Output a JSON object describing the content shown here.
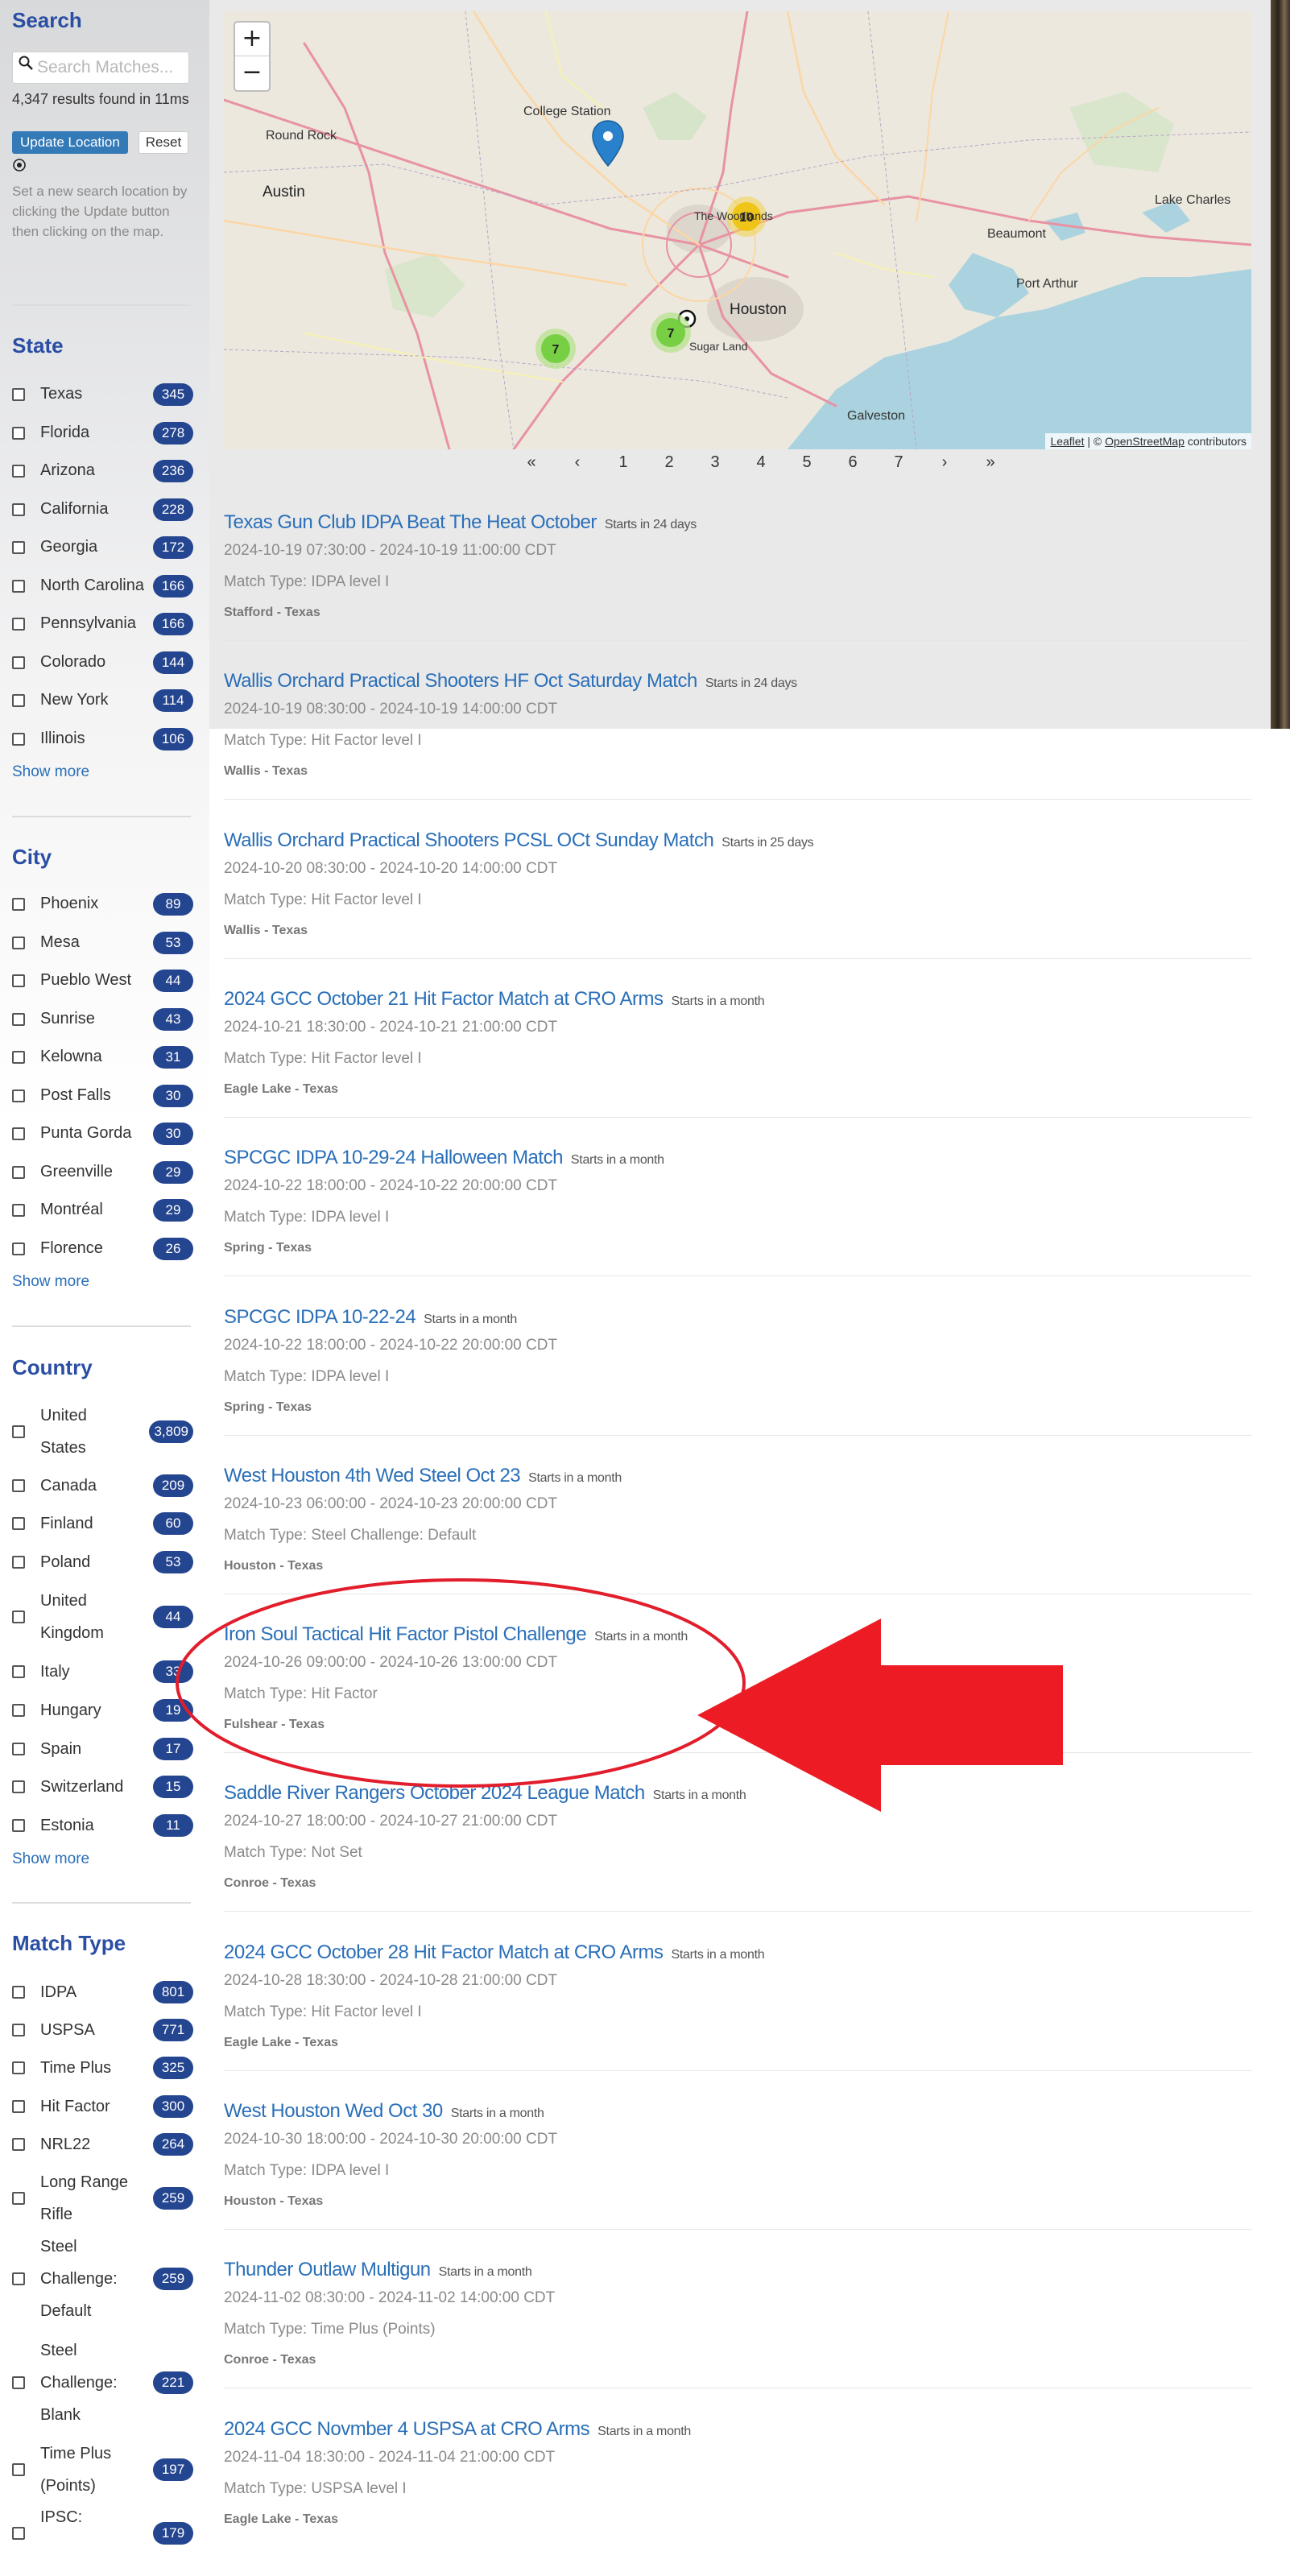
{
  "colors": {
    "accent": "#2a4ea3",
    "badge": "#24458f",
    "link": "#2a6fb8",
    "annotation_red": "#ed1c24"
  },
  "search": {
    "title": "Search",
    "placeholder": "Search Matches...",
    "results_text": "4,347 results found in 11ms",
    "update_button": "Update Location",
    "reset_button": "Reset",
    "help_text": "Set a new search location by clicking the Update button then clicking on the map."
  },
  "state": {
    "title": "State",
    "items": [
      {
        "label": "Texas",
        "count": "345"
      },
      {
        "label": "Florida",
        "count": "278"
      },
      {
        "label": "Arizona",
        "count": "236"
      },
      {
        "label": "California",
        "count": "228"
      },
      {
        "label": "Georgia",
        "count": "172"
      },
      {
        "label": "North Carolina",
        "count": "166"
      },
      {
        "label": "Pennsylvania",
        "count": "166"
      },
      {
        "label": "Colorado",
        "count": "144"
      },
      {
        "label": "New York",
        "count": "114"
      },
      {
        "label": "Illinois",
        "count": "106"
      }
    ],
    "show_more": "Show more"
  },
  "city": {
    "title": "City",
    "items": [
      {
        "label": "Phoenix",
        "count": "89"
      },
      {
        "label": "Mesa",
        "count": "53"
      },
      {
        "label": "Pueblo West",
        "count": "44"
      },
      {
        "label": "Sunrise",
        "count": "43"
      },
      {
        "label": "Kelowna",
        "count": "31"
      },
      {
        "label": "Post Falls",
        "count": "30"
      },
      {
        "label": "Punta Gorda",
        "count": "30"
      },
      {
        "label": "Greenville",
        "count": "29"
      },
      {
        "label": "Montréal",
        "count": "29"
      },
      {
        "label": "Florence",
        "count": "26"
      }
    ],
    "show_more": "Show more"
  },
  "country": {
    "title": "Country",
    "items": [
      {
        "label1": "United",
        "label2": "States",
        "count": "3,809"
      },
      {
        "label1": "Canada",
        "label2": "",
        "count": "209"
      },
      {
        "label1": "Finland",
        "label2": "",
        "count": "60"
      },
      {
        "label1": "Poland",
        "label2": "",
        "count": "53"
      },
      {
        "label1": "United",
        "label2": "Kingdom",
        "count": "44"
      },
      {
        "label1": "Italy",
        "label2": "",
        "count": "33"
      },
      {
        "label1": "Hungary",
        "label2": "",
        "count": "19"
      },
      {
        "label1": "Spain",
        "label2": "",
        "count": "17"
      },
      {
        "label1": "Switzerland",
        "label2": "",
        "count": "15"
      },
      {
        "label1": "Estonia",
        "label2": "",
        "count": "11"
      }
    ],
    "show_more": "Show more"
  },
  "match_type": {
    "title": "Match Type",
    "items": [
      {
        "lines": [
          "IDPA"
        ],
        "count": "801"
      },
      {
        "lines": [
          "USPSA"
        ],
        "count": "771"
      },
      {
        "lines": [
          "Time Plus"
        ],
        "count": "325"
      },
      {
        "lines": [
          "Hit Factor"
        ],
        "count": "300"
      },
      {
        "lines": [
          "NRL22"
        ],
        "count": "264"
      },
      {
        "lines": [
          "Long Range",
          "Rifle"
        ],
        "count": "259"
      },
      {
        "lines": [
          "Steel",
          "Challenge:",
          "Default"
        ],
        "count": "259"
      },
      {
        "lines": [
          "Steel",
          "Challenge:",
          "Blank"
        ],
        "count": "221"
      },
      {
        "lines": [
          "Time Plus",
          "(Points)"
        ],
        "count": "197"
      },
      {
        "lines": [
          "IPSC:",
          ""
        ],
        "count": "179"
      }
    ]
  },
  "map": {
    "zoom_in": "+",
    "zoom_out": "−",
    "attribution_leaflet": "Leaflet",
    "attribution_sep": " | © ",
    "attribution_osm": "OpenStreetMap",
    "attribution_tail": " contributors",
    "places": [
      "College Station",
      "Round Rock",
      "Austin",
      "Houston",
      "Beaumont",
      "Lake Charles",
      "Port Arthur",
      "Galveston",
      "Sugar Land",
      "The Woodlands"
    ],
    "clusters": [
      "10",
      "7",
      "7"
    ]
  },
  "pagination": [
    "«",
    "‹",
    "1",
    "2",
    "3",
    "4",
    "5",
    "6",
    "7",
    "›",
    "»"
  ],
  "matches": [
    {
      "title": "Texas Gun Club IDPA Beat The Heat October",
      "starts": "Starts in 24 days",
      "dates": "2024-10-19 07:30:00 - 2024-10-19 11:00:00 CDT",
      "type": "Match Type: IDPA level I",
      "location": "Stafford - Texas"
    },
    {
      "title": "Wallis Orchard Practical Shooters HF Oct Saturday Match",
      "starts": "Starts in 24 days",
      "dates": "2024-10-19 08:30:00 - 2024-10-19 14:00:00 CDT",
      "type": "Match Type: Hit Factor level I",
      "location": "Wallis - Texas"
    },
    {
      "title": "Wallis Orchard Practical Shooters PCSL OCt Sunday Match",
      "starts": "Starts in 25 days",
      "dates": "2024-10-20 08:30:00 - 2024-10-20 14:00:00 CDT",
      "type": "Match Type: Hit Factor level I",
      "location": "Wallis - Texas"
    },
    {
      "title": "2024 GCC October 21 Hit Factor Match at CRO Arms",
      "starts": "Starts in a month",
      "dates": "2024-10-21 18:30:00 - 2024-10-21 21:00:00 CDT",
      "type": "Match Type: Hit Factor level I",
      "location": "Eagle Lake - Texas"
    },
    {
      "title": "SPCGC IDPA 10-29-24 Halloween Match",
      "starts": "Starts in a month",
      "dates": "2024-10-22 18:00:00 - 2024-10-22 20:00:00 CDT",
      "type": "Match Type: IDPA level I",
      "location": "Spring - Texas"
    },
    {
      "title": "SPCGC IDPA 10-22-24",
      "starts": "Starts in a month",
      "dates": "2024-10-22 18:00:00 - 2024-10-22 20:00:00 CDT",
      "type": "Match Type: IDPA level I",
      "location": "Spring - Texas"
    },
    {
      "title": "West Houston 4th Wed Steel Oct 23",
      "starts": "Starts in a month",
      "dates": "2024-10-23 06:00:00 - 2024-10-23 20:00:00 CDT",
      "type": "Match Type: Steel Challenge: Default",
      "location": "Houston - Texas"
    },
    {
      "title": "Iron Soul Tactical Hit Factor Pistol Challenge",
      "starts": "Starts in a month",
      "dates": "2024-10-26 09:00:00 - 2024-10-26 13:00:00 CDT",
      "type": "Match Type: Hit Factor",
      "location": "Fulshear - Texas"
    },
    {
      "title": "Saddle River Rangers October 2024 League Match",
      "starts": "Starts in a month",
      "dates": "2024-10-27 18:00:00 - 2024-10-27 21:00:00 CDT",
      "type": "Match Type: Not Set",
      "location": "Conroe - Texas"
    },
    {
      "title": "2024 GCC October 28 Hit Factor Match at CRO Arms",
      "starts": "Starts in a month",
      "dates": "2024-10-28 18:30:00 - 2024-10-28 21:00:00 CDT",
      "type": "Match Type: Hit Factor level I",
      "location": "Eagle Lake - Texas"
    },
    {
      "title": "West Houston Wed Oct 30",
      "starts": "Starts in a month",
      "dates": "2024-10-30 18:00:00 - 2024-10-30 20:00:00 CDT",
      "type": "Match Type: IDPA level I",
      "location": "Houston - Texas"
    },
    {
      "title": "Thunder Outlaw Multigun",
      "starts": "Starts in a month",
      "dates": "2024-11-02 08:30:00 - 2024-11-02 14:00:00 CDT",
      "type": "Match Type: Time Plus (Points)",
      "location": "Conroe - Texas"
    },
    {
      "title": "2024 GCC Novmber 4 USPSA at CRO Arms",
      "starts": "Starts in a month",
      "dates": "2024-11-04 18:30:00 - 2024-11-04 21:00:00 CDT",
      "type": "Match Type: USPSA level I",
      "location": "Eagle Lake - Texas"
    }
  ]
}
